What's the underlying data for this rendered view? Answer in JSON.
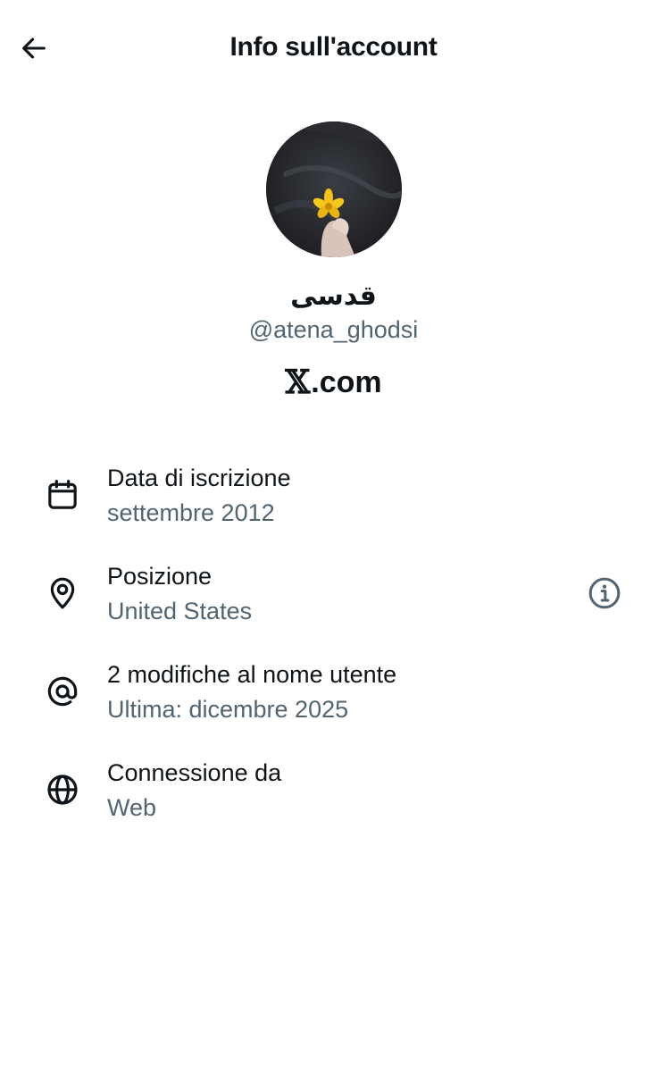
{
  "header": {
    "back_icon": "arrow-left-icon",
    "title": "Info sull'account"
  },
  "profile": {
    "display_name": "قدسی",
    "handle": "@atena_ghodsi",
    "brand_x": "𝕏",
    "brand_rest": ".com"
  },
  "info_rows": [
    {
      "icon": "calendar-icon",
      "title": "Data di iscrizione",
      "value": "settembre 2012"
    },
    {
      "icon": "location-pin-icon",
      "title": "Posizione",
      "value": "United States",
      "action_icon": "info-circle-icon"
    },
    {
      "icon": "at-sign-icon",
      "title": "2 modifiche al nome utente",
      "value": "Ultima: dicembre 2025"
    },
    {
      "icon": "globe-icon",
      "title": "Connessione da",
      "value": "Web"
    }
  ],
  "colors": {
    "text_primary": "#0f1419",
    "text_secondary": "#536471",
    "background": "#ffffff"
  }
}
